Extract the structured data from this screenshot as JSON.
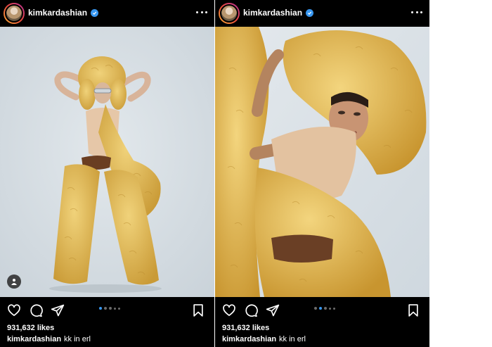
{
  "posts": [
    {
      "username": "kimkardashian",
      "likes": "931,632 likes",
      "caption_user": "kimkardashian",
      "caption_text": "kk in erl",
      "carousel": {
        "count": 5,
        "active_index": 0
      },
      "has_user_tag": true,
      "photo_icon": "full-body-fur-outfit-photo"
    },
    {
      "username": "kimkardashian",
      "likes": "931,632 likes",
      "caption_user": "kimkardashian",
      "caption_text": "kk in erl",
      "carousel": {
        "count": 5,
        "active_index": 1
      },
      "has_user_tag": false,
      "photo_icon": "closeup-fur-hat-photo"
    }
  ],
  "icons": [
    "heart-icon",
    "comment-icon",
    "share-icon",
    "bookmark-icon",
    "more-icon",
    "verified-icon",
    "user-tag-icon"
  ],
  "colors": {
    "background": "#000000",
    "text": "#ffffff",
    "verified_blue": "#3897f0",
    "carousel_active": "#3897f0",
    "fur_yellow": "#e8c25a",
    "photo_backdrop": "#d5dde3"
  }
}
